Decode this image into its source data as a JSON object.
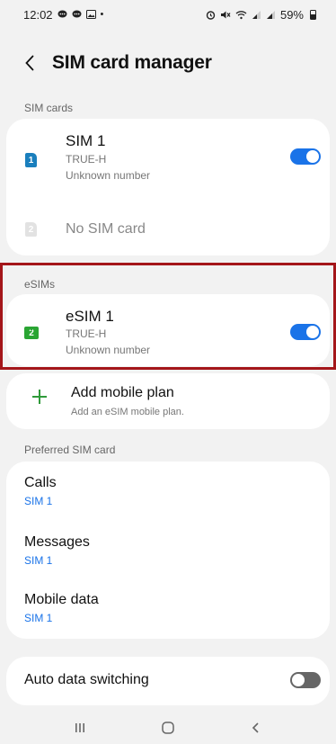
{
  "status_bar": {
    "time": "12:02",
    "battery": "59%",
    "left_icons": [
      "chat-bubble-icon",
      "chat-bubble-icon",
      "image-icon",
      "dot-icon"
    ],
    "right_icons": [
      "alarm-icon",
      "mute-icon",
      "wifi-icon",
      "signal-icon",
      "signal-icon",
      "battery-icon"
    ]
  },
  "header": {
    "title": "SIM card manager",
    "back_icon": "chevron-left-icon"
  },
  "sim_cards": {
    "label": "SIM cards",
    "sim1": {
      "icon_num": "1",
      "name": "SIM 1",
      "carrier": "TRUE-H",
      "number": "Unknown number",
      "enabled": true
    },
    "sim2": {
      "icon_num": "2",
      "name": "No SIM card"
    }
  },
  "esims": {
    "label": "eSIMs",
    "esim1": {
      "icon_num": "2",
      "name": "eSIM 1",
      "carrier": "TRUE-H",
      "number": "Unknown number",
      "enabled": true
    }
  },
  "add_plan": {
    "title": "Add mobile plan",
    "subtitle": "Add an eSIM mobile plan."
  },
  "preferred": {
    "label": "Preferred SIM card",
    "calls": {
      "title": "Calls",
      "value": "SIM 1"
    },
    "messages": {
      "title": "Messages",
      "value": "SIM 1"
    },
    "mobile_data": {
      "title": "Mobile data",
      "value": "SIM 1"
    }
  },
  "auto_switch": {
    "title": "Auto data switching",
    "enabled": false
  },
  "colors": {
    "accent": "#1a73e8",
    "sim_blue": "#1a7fbd",
    "esim_green": "#2aa533",
    "highlight": "#a4161a"
  },
  "nav_bar": {
    "icons": [
      "recents-icon",
      "home-icon",
      "back-icon"
    ]
  }
}
